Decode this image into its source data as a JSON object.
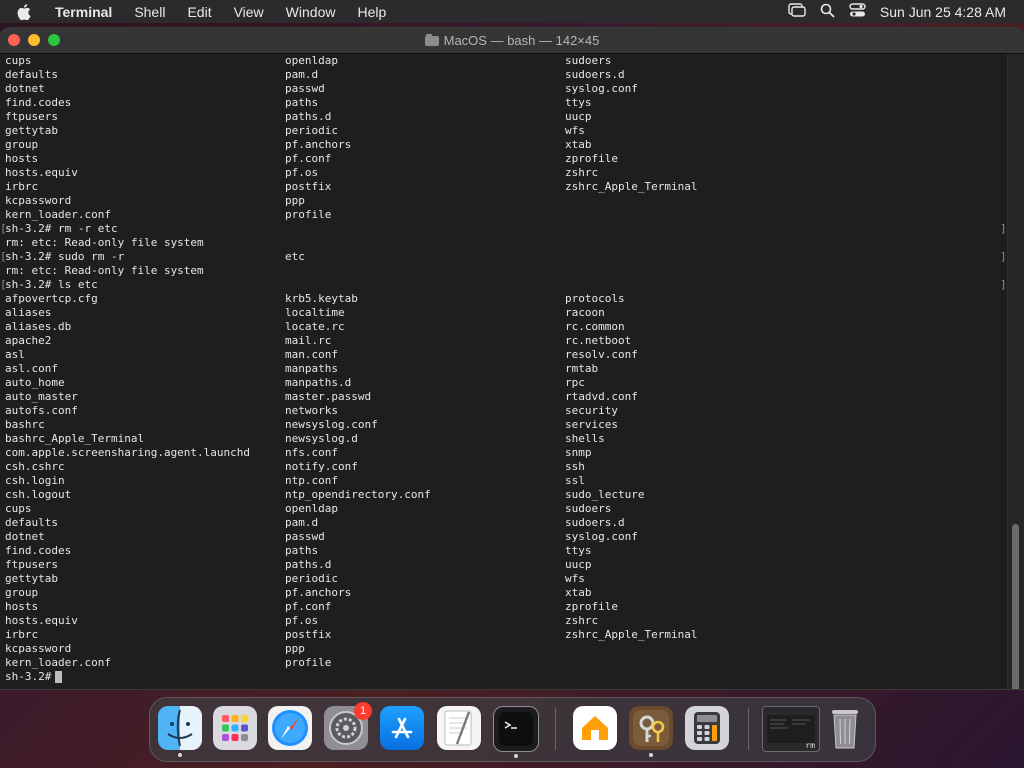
{
  "menubar": {
    "app": "Terminal",
    "items": [
      "Shell",
      "Edit",
      "View",
      "Window",
      "Help"
    ],
    "clock": "Sun Jun 25  4:28 AM"
  },
  "window": {
    "title": "MacOS — bash — 142×45"
  },
  "terminal": {
    "lines": [
      {
        "c": [
          "cups",
          "openldap",
          "sudoers"
        ]
      },
      {
        "c": [
          "defaults",
          "pam.d",
          "sudoers.d"
        ]
      },
      {
        "c": [
          "dotnet",
          "passwd",
          "syslog.conf"
        ]
      },
      {
        "c": [
          "find.codes",
          "paths",
          "ttys"
        ]
      },
      {
        "c": [
          "ftpusers",
          "paths.d",
          "uucp"
        ]
      },
      {
        "c": [
          "gettytab",
          "periodic",
          "wfs"
        ]
      },
      {
        "c": [
          "group",
          "pf.anchors",
          "xtab"
        ]
      },
      {
        "c": [
          "hosts",
          "pf.conf",
          "zprofile"
        ]
      },
      {
        "c": [
          "hosts.equiv",
          "pf.os",
          "zshrc"
        ]
      },
      {
        "c": [
          "irbrc",
          "postfix",
          "zshrc_Apple_Terminal"
        ]
      },
      {
        "c": [
          "kcpassword",
          "ppp",
          ""
        ]
      },
      {
        "c": [
          "kern_loader.conf",
          "profile",
          ""
        ]
      },
      {
        "cmd": true,
        "c": [
          "sh-3.2# rm -r etc",
          "",
          ""
        ]
      },
      {
        "c": [
          "rm: etc: Read-only file system",
          "",
          ""
        ]
      },
      {
        "cmd": true,
        "c": [
          "sh-3.2# sudo rm -r",
          "etc",
          ""
        ]
      },
      {
        "c": [
          "rm: etc: Read-only file system",
          "",
          ""
        ]
      },
      {
        "cmd": true,
        "c": [
          "sh-3.2# ls etc",
          "",
          ""
        ]
      },
      {
        "c": [
          "afpovertcp.cfg",
          "krb5.keytab",
          "protocols"
        ]
      },
      {
        "c": [
          "aliases",
          "localtime",
          "racoon"
        ]
      },
      {
        "c": [
          "aliases.db",
          "locate.rc",
          "rc.common"
        ]
      },
      {
        "c": [
          "apache2",
          "mail.rc",
          "rc.netboot"
        ]
      },
      {
        "c": [
          "asl",
          "man.conf",
          "resolv.conf"
        ]
      },
      {
        "c": [
          "asl.conf",
          "manpaths",
          "rmtab"
        ]
      },
      {
        "c": [
          "auto_home",
          "manpaths.d",
          "rpc"
        ]
      },
      {
        "c": [
          "auto_master",
          "master.passwd",
          "rtadvd.conf"
        ]
      },
      {
        "c": [
          "autofs.conf",
          "networks",
          "security"
        ]
      },
      {
        "c": [
          "bashrc",
          "newsyslog.conf",
          "services"
        ]
      },
      {
        "c": [
          "bashrc_Apple_Terminal",
          "newsyslog.d",
          "shells"
        ]
      },
      {
        "c": [
          "com.apple.screensharing.agent.launchd",
          "nfs.conf",
          "snmp"
        ]
      },
      {
        "c": [
          "csh.cshrc",
          "notify.conf",
          "ssh"
        ]
      },
      {
        "c": [
          "csh.login",
          "ntp.conf",
          "ssl"
        ]
      },
      {
        "c": [
          "csh.logout",
          "ntp_opendirectory.conf",
          "sudo_lecture"
        ]
      },
      {
        "c": [
          "cups",
          "openldap",
          "sudoers"
        ]
      },
      {
        "c": [
          "defaults",
          "pam.d",
          "sudoers.d"
        ]
      },
      {
        "c": [
          "dotnet",
          "passwd",
          "syslog.conf"
        ]
      },
      {
        "c": [
          "find.codes",
          "paths",
          "ttys"
        ]
      },
      {
        "c": [
          "ftpusers",
          "paths.d",
          "uucp"
        ]
      },
      {
        "c": [
          "gettytab",
          "periodic",
          "wfs"
        ]
      },
      {
        "c": [
          "group",
          "pf.anchors",
          "xtab"
        ]
      },
      {
        "c": [
          "hosts",
          "pf.conf",
          "zprofile"
        ]
      },
      {
        "c": [
          "hosts.equiv",
          "pf.os",
          "zshrc"
        ]
      },
      {
        "c": [
          "irbrc",
          "postfix",
          "zshrc_Apple_Terminal"
        ]
      },
      {
        "c": [
          "kcpassword",
          "ppp",
          ""
        ]
      },
      {
        "c": [
          "kern_loader.conf",
          "profile",
          ""
        ]
      }
    ],
    "prompt": "sh-3.2#"
  },
  "dock": {
    "items": [
      {
        "name": "finder",
        "running": true
      },
      {
        "name": "launchpad",
        "running": false
      },
      {
        "name": "safari",
        "running": false
      },
      {
        "name": "system-settings",
        "running": false,
        "badge": "1"
      },
      {
        "name": "app-store",
        "running": false
      },
      {
        "name": "textedit",
        "running": false
      },
      {
        "name": "terminal",
        "running": true
      },
      {
        "name": "home",
        "running": false
      },
      {
        "name": "keychain-access",
        "running": true
      },
      {
        "name": "calculator",
        "running": false
      },
      {
        "name": "terminal-window-thumbnail",
        "label": "rm"
      },
      {
        "name": "trash"
      }
    ]
  }
}
